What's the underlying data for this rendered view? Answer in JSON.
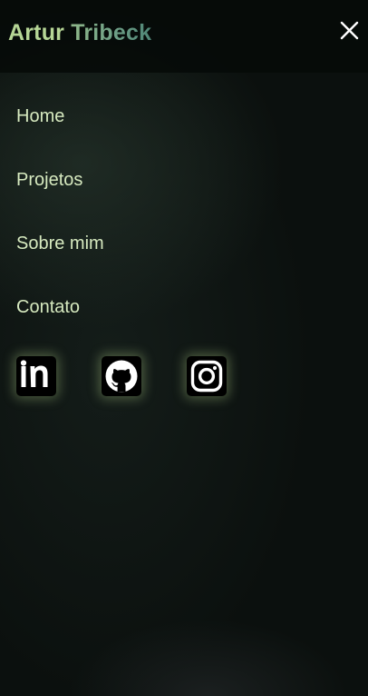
{
  "header": {
    "brand_first": "Artur",
    "brand_last": "Tribeck",
    "close_icon": "close-icon"
  },
  "nav": {
    "items": [
      {
        "label": "Home"
      },
      {
        "label": "Projetos"
      },
      {
        "label": "Sobre mim"
      },
      {
        "label": "Contato"
      }
    ]
  },
  "socials": [
    {
      "icon": "linkedin-icon"
    },
    {
      "icon": "github-icon"
    },
    {
      "icon": "instagram-icon"
    }
  ],
  "colors": {
    "background": "#0b100e",
    "nav_text": "#d6e9bf",
    "brand_first": "#b6d696",
    "brand_last": "#6e9f86",
    "glow": "#b8d68c"
  }
}
